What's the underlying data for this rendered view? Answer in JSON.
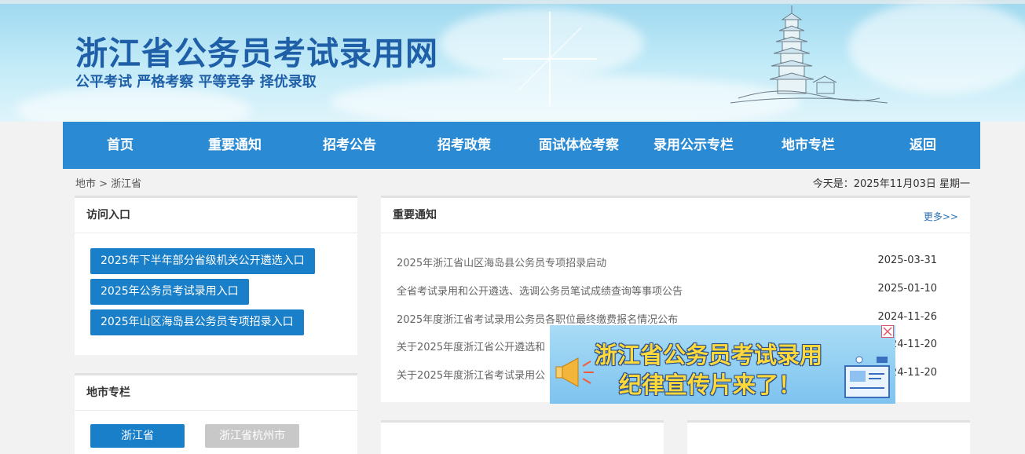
{
  "header": {
    "title": "浙江省公务员考试录用网",
    "slogan": "公平考试 严格考察 平等竞争 择优录取"
  },
  "nav": [
    {
      "label": "首页"
    },
    {
      "label": "重要通知"
    },
    {
      "label": "招考公告"
    },
    {
      "label": "招考政策"
    },
    {
      "label": "面试体检考察"
    },
    {
      "label": "录用公示专栏"
    },
    {
      "label": "地市专栏"
    },
    {
      "label": "返回"
    }
  ],
  "breadcrumb": "地市 > 浙江省",
  "today": "今天是：2025年11月03日 星期一",
  "access": {
    "title": "访问入口",
    "buttons": [
      {
        "label": "2025年下半年部分省级机关公开遴选入口"
      },
      {
        "label": "2025年公务员考试录用入口"
      },
      {
        "label": "2025年山区海岛县公务员专项招录入口"
      }
    ]
  },
  "cities": {
    "title": "地市专栏",
    "buttons": [
      {
        "label": "浙江省"
      },
      {
        "label": "浙江省杭州市"
      }
    ]
  },
  "notices": {
    "title": "重要通知",
    "more": "更多>>",
    "items": [
      {
        "title": "2025年浙江省山区海岛县公务员专项招录启动",
        "date": "2025-03-31"
      },
      {
        "title": "全省考试录用和公开遴选、选调公务员笔试成绩查询等事项公告",
        "date": "2025-01-10"
      },
      {
        "title": "2025年度浙江省考试录用公务员各职位最终缴费报名情况公布",
        "date": "2024-11-26"
      },
      {
        "title": "关于2025年度浙江省公开遴选和",
        "date": "2024-11-20"
      },
      {
        "title": "关于2025年度浙江省考试录用公",
        "date": "2024-11-20"
      }
    ]
  },
  "ad": {
    "line1": "浙江省公务员考试录用",
    "line2": "纪律宣传片来了！"
  },
  "colors": {
    "nav": "#2a8ad3",
    "button": "#1a7fc9",
    "title": "#1f5fa8",
    "city_inactive": "#c8c8c8"
  }
}
